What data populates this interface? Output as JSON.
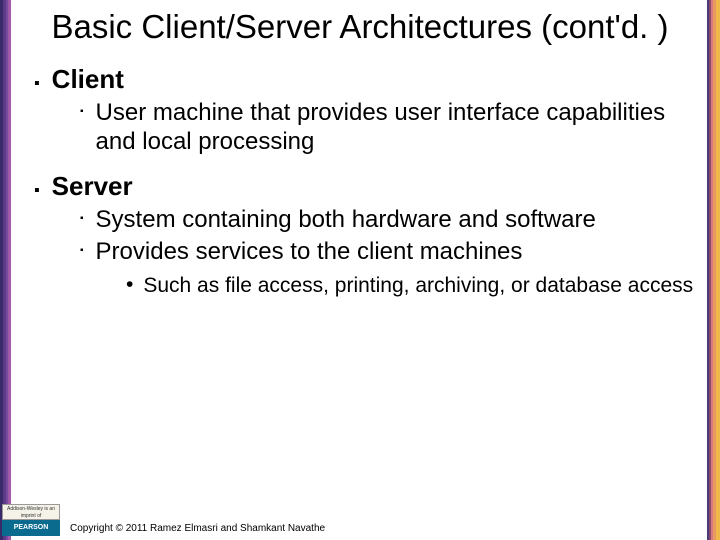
{
  "title": "Basic Client/Server Architectures (cont'd. )",
  "sections": [
    {
      "heading": "Client",
      "items": [
        {
          "text": "User machine that provides user interface capabilities and local processing"
        }
      ],
      "subitems": []
    },
    {
      "heading": "Server",
      "items": [
        {
          "text": "System containing both hardware and software"
        },
        {
          "text": "Provides services to the client machines"
        }
      ],
      "subitems": [
        {
          "text": "Such as file access, printing, archiving, or database access"
        }
      ]
    }
  ],
  "logo": {
    "top": "Addison-Wesley is an imprint of",
    "bottom": "PEARSON"
  },
  "copyright": "Copyright © 2011 Ramez Elmasri and Shamkant Navathe",
  "stripes": {
    "left": [
      "#3a2a6a",
      "#5b3a8a",
      "#7a4aa0",
      "#a05aa8",
      "#c06a98",
      "#d87a80",
      "#e89a60",
      "#f0b848"
    ],
    "right": [
      "#2a5a2a",
      "#3a7a3a",
      "#5a9a4a",
      "#8aba5a",
      "#b8d068",
      "#e0d858",
      "#f0c848",
      "#f8b838"
    ]
  }
}
